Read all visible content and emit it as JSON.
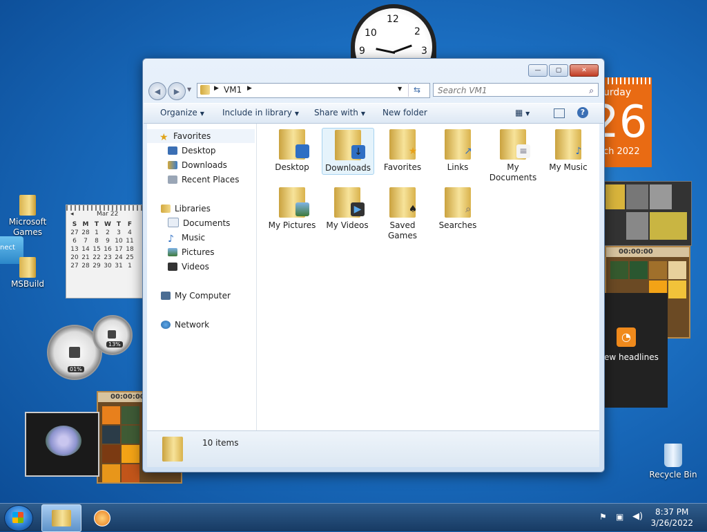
{
  "desktop": {
    "icons": [
      {
        "label": "Microsoft Games"
      },
      {
        "label": "MSBuild"
      },
      {
        "label": "Recycle Bin"
      }
    ],
    "connect_label": "nect"
  },
  "gadgets": {
    "clock_numbers": [
      "12",
      "2",
      "3",
      "9",
      "10"
    ],
    "calendar_big": {
      "day_text": "urday",
      "date": "26",
      "month": "ch 2022"
    },
    "mini_calendar": {
      "month": "Mar 22",
      "weekdays": [
        "S",
        "M",
        "T",
        "W",
        "T",
        "F"
      ],
      "rows": [
        [
          "27",
          "28",
          "1",
          "2",
          "3",
          "4"
        ],
        [
          "6",
          "7",
          "8",
          "9",
          "10",
          "11"
        ],
        [
          "13",
          "14",
          "15",
          "16",
          "17",
          "18"
        ],
        [
          "20",
          "21",
          "22",
          "23",
          "24",
          "25"
        ],
        [
          "27",
          "28",
          "29",
          "30",
          "31",
          "1"
        ]
      ]
    },
    "cpu_meter": {
      "label": "01%"
    },
    "mem_meter": {
      "label": "13%"
    },
    "puzzle_timer": "00:00:00",
    "puzzle_timer_right": "00:00:00",
    "news_label": "ew headlines"
  },
  "window": {
    "address_path": [
      "VM1"
    ],
    "search_placeholder": "Search VM1",
    "toolbar": {
      "organize": "Organize",
      "include": "Include in library",
      "share": "Share with",
      "new_folder": "New folder"
    },
    "nav": {
      "favorites": "Favorites",
      "desktop": "Desktop",
      "downloads": "Downloads",
      "recent": "Recent Places",
      "libraries": "Libraries",
      "documents": "Documents",
      "music": "Music",
      "pictures": "Pictures",
      "videos": "Videos",
      "computer": "My Computer",
      "network": "Network"
    },
    "items": [
      {
        "label": "Desktop",
        "overlay": "desktop"
      },
      {
        "label": "Downloads",
        "overlay": "downloads"
      },
      {
        "label": "Favorites",
        "overlay": "star"
      },
      {
        "label": "Links",
        "overlay": "arrow"
      },
      {
        "label": "My Documents",
        "overlay": "document"
      },
      {
        "label": "My Music",
        "overlay": "music"
      },
      {
        "label": "My Pictures",
        "overlay": "picture"
      },
      {
        "label": "My Videos",
        "overlay": "film"
      },
      {
        "label": "Saved Games",
        "overlay": "spade"
      },
      {
        "label": "Searches",
        "overlay": "magnifier"
      }
    ],
    "status_count": "10 items"
  },
  "taskbar": {
    "time": "8:37 PM",
    "date": "3/26/2022"
  },
  "colors": {
    "accent": "#1b6fc2",
    "calendar_orange": "#e96b13",
    "close_red": "#c13d24"
  }
}
